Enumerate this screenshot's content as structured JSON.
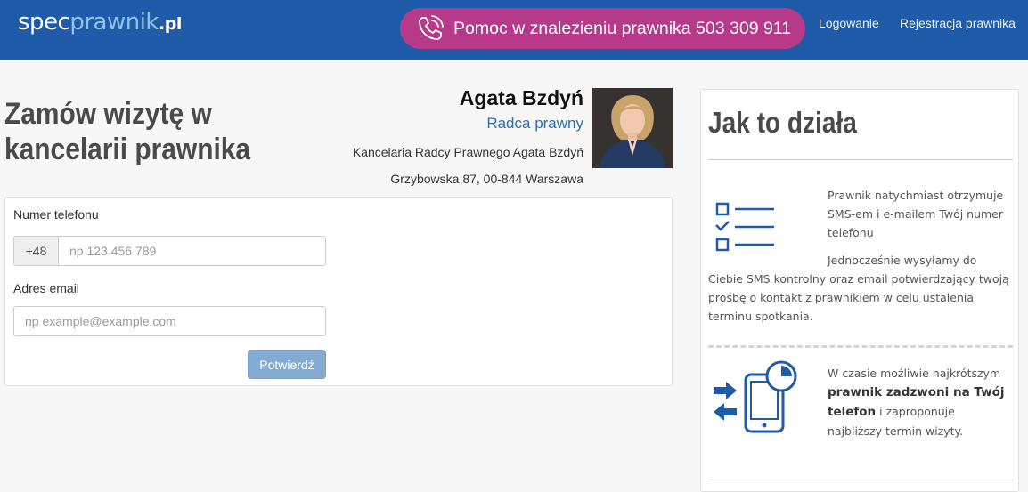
{
  "header": {
    "logo": {
      "part1": "spec",
      "part2": "prawnik",
      "part3": ".pl"
    },
    "helpline_text": "Pomoc w znalezieniu prawnika 503 309 911",
    "login_label": "Logowanie",
    "register_label": "Rejestracja prawnika",
    "brand_color": "#1f5ba8",
    "helpline_color": "#b73a8a",
    "phone_icon": "phone-ringing-icon"
  },
  "page": {
    "title": "Zamów wizytę w kancelarii prawnika"
  },
  "lawyer": {
    "name": "Agata Bzdyń",
    "role": "Radca prawny",
    "firm": "Kancelaria Radcy Prawnego Agata Bzdyń",
    "address": "Grzybowska 87, 00-844 Warszawa"
  },
  "form": {
    "phone_label": "Numer telefonu",
    "phone_prefix": "+48",
    "phone_placeholder": "np 123 456 789",
    "phone_value": "",
    "email_label": "Adres email",
    "email_placeholder": "np example@example.com",
    "email_value": "",
    "submit_label": "Potwierdź"
  },
  "how_it_works": {
    "title": "Jak to działa",
    "step1_icon": "checklist-icon",
    "step1_text_a": "Prawnik natychmiast otrzymuje SMS-em i e-mailem Twój numer telefonu",
    "step1_text_b": "Jednocześnie wysyłamy do Ciebie SMS kontrolny oraz email potwierdzający twoją prośbę o kontakt z prawnikiem w celu ustalenia terminu spotkania.",
    "step2_icon": "phone-timer-icon",
    "step2_pre": "W czasie możliwie najkrótszym",
    "step2_bold": "prawnik zadzwoni na Twój telefon",
    "step2_post": "i zaproponuje najbliższy termin wizyty."
  }
}
